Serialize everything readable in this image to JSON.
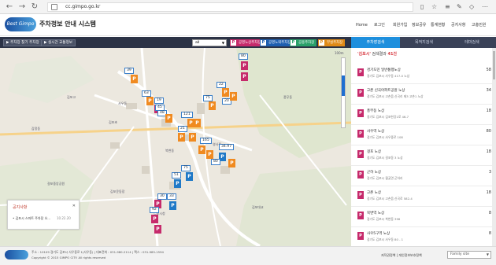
{
  "browser": {
    "url": "cc.gimpo.go.kr"
  },
  "header": {
    "logo_text": "Best Gimpo",
    "site_title": "주차정보 안내 시스템",
    "nav": [
      "Home",
      "로그인",
      "회원가입",
      "정보공유",
      "통계현황",
      "공지사항",
      "고충민원"
    ]
  },
  "toolbar": {
    "btn_find": "▶ 주차장 찾기 주차장",
    "btn_realtime": "▶ 실시간 교통정보",
    "select_value": "all",
    "legend": [
      {
        "label": "공영노상주차장",
        "color": "#c62a6b"
      },
      {
        "label": "공영노외주차장",
        "color": "#1e5fb0"
      },
      {
        "label": "공용주차장",
        "color": "#2aa06a"
      },
      {
        "label": "부설주차장",
        "color": "#e08a16"
      }
    ]
  },
  "tabs": [
    "주차장검색",
    "목적지검색",
    "테마검색"
  ],
  "results": {
    "header_prefix": "'김포시'",
    "header_mid": " 검색결과 ",
    "header_count": "41건",
    "items": [
      {
        "name": "경기도민 일반통행노상",
        "addr": "경기도 김포시 사우동 417-0 노상",
        "num": "58"
      },
      {
        "name": "고촌 신곡아파트공원 노상",
        "addr": "경기도 김포시 고촌읍 신곡리 제3 고촌1 노상",
        "num": "34"
      },
      {
        "name": "풍무동 노상",
        "addr": "경기도 김포시 김포한강1로 46-7",
        "num": "18"
      },
      {
        "name": "사우역 노상",
        "addr": "경기도 김포시 사우중로 108",
        "num": "80"
      },
      {
        "name": "걸포 노상",
        "addr": "경기도 김포시 걸포동 3 노상",
        "num": "18"
      },
      {
        "name": "군하 노상",
        "addr": "경기도 김포시 월곶면 군하리",
        "num": "3"
      },
      {
        "name": "고촌 노상",
        "addr": "경기도 김포시 고촌읍 신곡로 582-4",
        "num": "18"
      },
      {
        "name": "북변역 노상",
        "addr": "경기도 김포시 북변동 396",
        "num": "8"
      },
      {
        "name": "사우5구역 노상",
        "addr": "경기도 김포시 사우동 80 - 1",
        "num": "8"
      }
    ]
  },
  "notice": {
    "title": "공지사항",
    "close": "✕",
    "row_text": "• 김포시 스마트 주차장 오...",
    "row_date": "10.22.20"
  },
  "map": {
    "scale": "100m",
    "labels": [
      "사우동",
      "김포시청",
      "김포초",
      "풍무동",
      "감정동",
      "북변동",
      "김포대교",
      "걸포중앙공원",
      "김포운동장",
      "김포고",
      "김포시청",
      "영사정"
    ],
    "markers": [
      {
        "type": "o",
        "label": "80"
      },
      {
        "type": "o",
        "label": "39"
      },
      {
        "type": "o",
        "label": "63"
      },
      {
        "type": "o",
        "label": "19"
      },
      {
        "type": "o",
        "label": "45"
      },
      {
        "type": "o",
        "label": "48"
      },
      {
        "type": "o",
        "label": "121"
      },
      {
        "type": "o",
        "label": "22"
      },
      {
        "type": "o",
        "label": "20"
      },
      {
        "type": "o",
        "label": "75"
      },
      {
        "type": "o",
        "label": "21"
      },
      {
        "type": "o",
        "label": "165"
      },
      {
        "type": "o",
        "label": "165"
      },
      {
        "type": "o",
        "label": "34.97"
      },
      {
        "type": "b",
        "label": "80"
      },
      {
        "type": "b",
        "label": "75"
      },
      {
        "type": "b",
        "label": "51"
      },
      {
        "type": "b",
        "label": "30"
      },
      {
        "type": "b",
        "label": "33"
      },
      {
        "type": "o",
        "label": "92"
      },
      {
        "type": "o",
        "label": "5"
      }
    ]
  },
  "footer": {
    "address": "주소 : 10109 경기도 김포시 사우중로 1(사우동) | 대표전화 : 031-980-2114 | 팩스 : 031-985-1594",
    "copyright": "Copyright © 2015 GIMPO CITY. All rights reserved",
    "links": "저작권정책 | 개인정보보호정책",
    "family_site": "Family site"
  }
}
